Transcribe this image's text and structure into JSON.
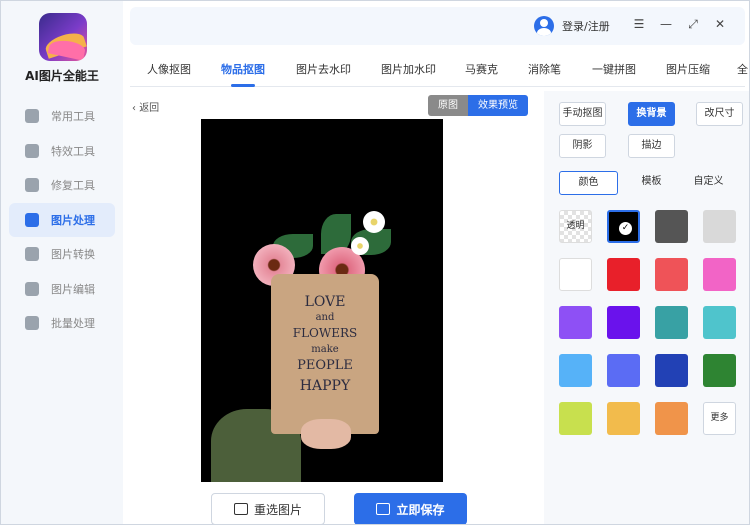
{
  "app": {
    "name": "AI图片全能王"
  },
  "sidebar": {
    "items": [
      {
        "label": "常用工具",
        "icon": "grid-icon"
      },
      {
        "label": "特效工具",
        "icon": "sparkle-icon"
      },
      {
        "label": "修复工具",
        "icon": "wrench-icon"
      },
      {
        "label": "图片处理",
        "icon": "image-wave-icon",
        "active": true
      },
      {
        "label": "图片转换",
        "icon": "swap-icon"
      },
      {
        "label": "图片编辑",
        "icon": "edit-icon"
      },
      {
        "label": "批量处理",
        "icon": "upload-icon"
      }
    ]
  },
  "header": {
    "login_label": "登录/注册",
    "controls": {
      "menu": "☰",
      "minimize": "—",
      "maximize": "⤢",
      "close": "✕"
    }
  },
  "tabs": [
    {
      "label": "人像抠图"
    },
    {
      "label": "物品抠图",
      "active": true
    },
    {
      "label": "图片去水印"
    },
    {
      "label": "图片加水印"
    },
    {
      "label": "马赛克"
    },
    {
      "label": "消除笔"
    },
    {
      "label": "一键拼图"
    },
    {
      "label": "图片压缩"
    },
    {
      "label": "全"
    }
  ],
  "preview": {
    "back_label": "返回",
    "toggle": {
      "original": "原图",
      "effect": "效果预览"
    },
    "bag_text": [
      "LOVE",
      "and",
      "FLOWERS",
      "make",
      "PEOPLE",
      "HAPPY"
    ]
  },
  "actions": {
    "reselect": "重选图片",
    "save": "立即保存"
  },
  "panel": {
    "tools": [
      {
        "label": "手动抠图"
      },
      {
        "label": "换背景",
        "active": true
      },
      {
        "label": "改尺寸"
      },
      {
        "label": "阴影"
      },
      {
        "label": "描边"
      }
    ],
    "sub_tabs": [
      {
        "label": "颜色",
        "active": true
      },
      {
        "label": "模板"
      },
      {
        "label": "自定义"
      }
    ],
    "transparent_label": "透明",
    "more_label": "更多",
    "colors": [
      "transparent",
      "#000000",
      "#555555",
      "#d9d9d9",
      "#ffffff",
      "#e8202a",
      "#ef5358",
      "#f264c6",
      "#8e50f5",
      "#6a12ec",
      "#38a1a4",
      "#4fc4cc",
      "#56b2f8",
      "#5b6cf4",
      "#2241b5",
      "#2e8432",
      "#c8e04e",
      "#f2bb4c",
      "#f0944a",
      "more"
    ],
    "selected_color": "#000000"
  },
  "accent_color": "#2c6ee8"
}
